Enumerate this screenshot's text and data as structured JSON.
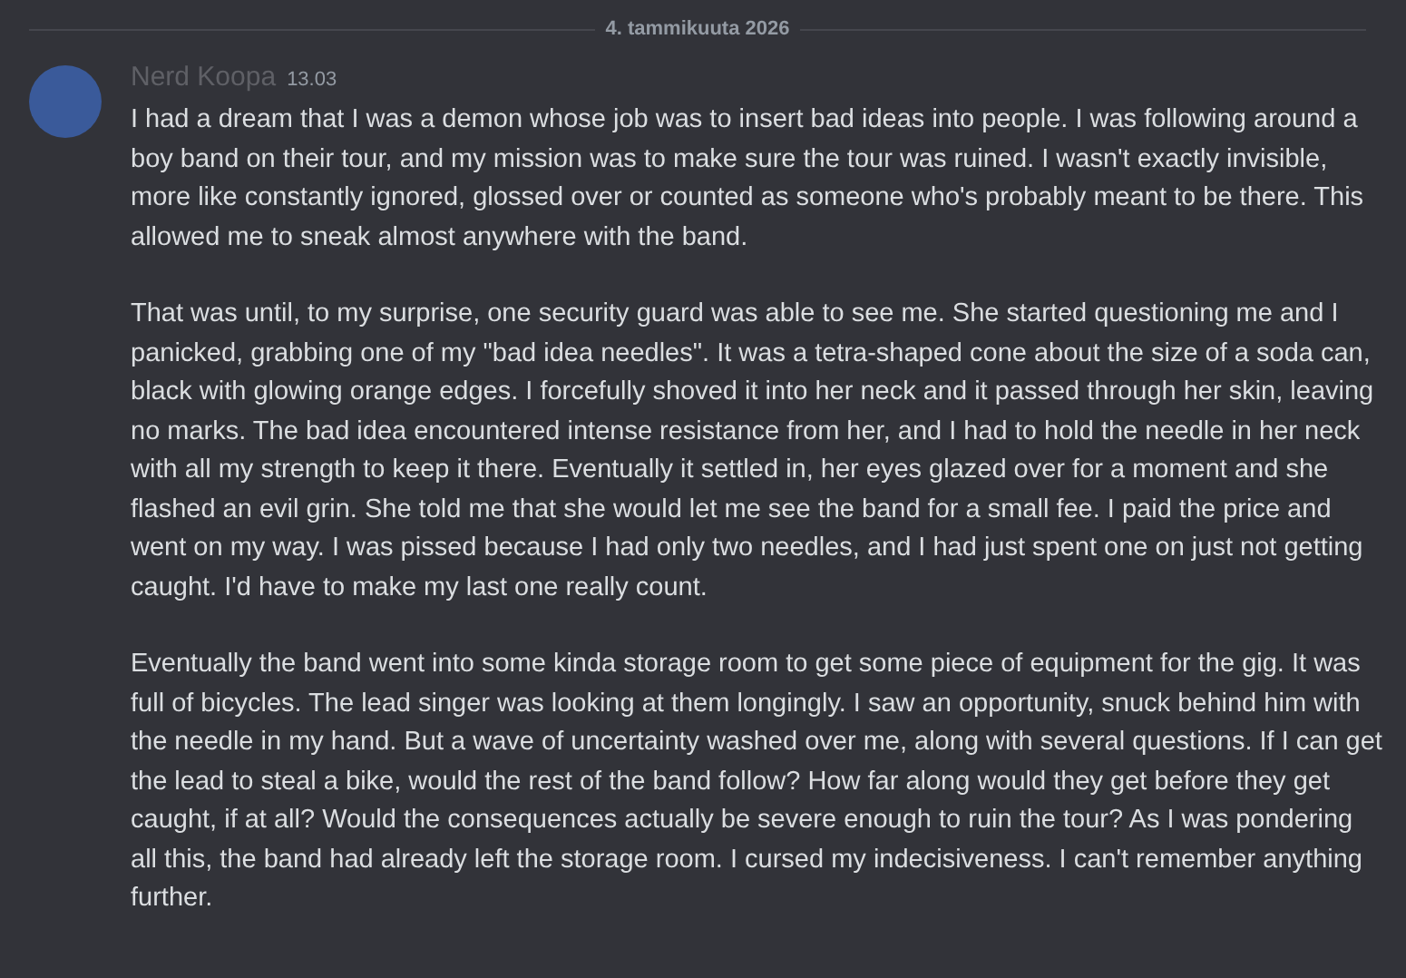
{
  "date_divider": "4. tammikuuta 2026",
  "message": {
    "author": "Nerd Koopa",
    "time": "13.03",
    "paragraphs": [
      "I had a dream that I was a demon whose job was to insert bad ideas into people. I was following around a boy band on their tour, and my mission was to make sure the tour was ruined. I wasn't exactly invisible, more like constantly ignored, glossed over or counted as someone who's probably meant to be there. This allowed me to sneak almost anywhere with the band.",
      "That was until, to my surprise, one security guard was able to see me. She started questioning me and I panicked, grabbing one of my \"bad idea needles\". It was a tetra-shaped cone about the size of a soda can, black with glowing orange edges. I forcefully shoved it into her neck and it passed through her skin, leaving no marks. The bad idea encountered intense resistance from her, and I had to hold the needle in her neck with all my strength to keep it there. Eventually it settled in, her eyes glazed over for a moment and she flashed an evil grin. She told me that she would let me see the band for a small fee. I paid the price and went on my way. I was pissed because I had only two needles, and I had just spent one on just not getting caught. I'd have to make my last one really count.",
      "Eventually the band went into some kinda storage room to get some piece of equipment for the gig. It was full of bicycles. The lead singer was looking at them longingly. I saw an opportunity, snuck behind him with the needle in my hand. But a wave of uncertainty washed over me, along with several questions. If I can get the lead to steal a bike, would the rest of the band follow? How far along would they get before they get caught, if at all? Would the consequences actually be severe enough to ruin the tour? As I was pondering all this, the band had already left the storage room. I cursed my indecisiveness. I can't remember anything further."
    ]
  }
}
